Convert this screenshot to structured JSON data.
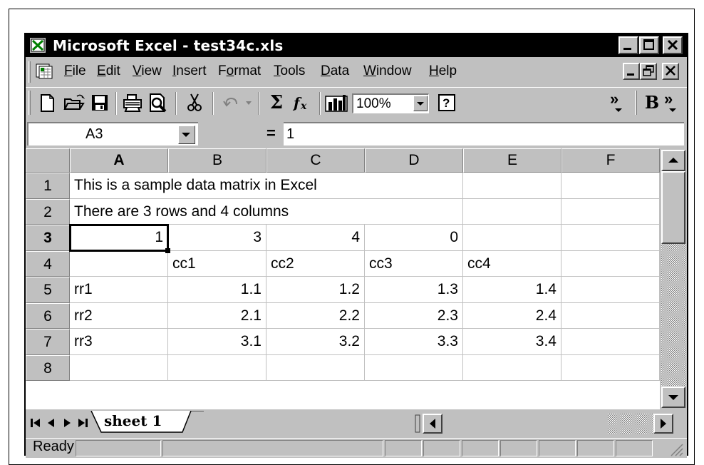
{
  "window": {
    "title": "Microsoft Excel - test34c.xls"
  },
  "menu": {
    "items": [
      "File",
      "Edit",
      "View",
      "Insert",
      "Format",
      "Tools",
      "Data",
      "Window",
      "Help"
    ],
    "mnemonics": [
      "F",
      "E",
      "V",
      "I",
      "o",
      "T",
      "D",
      "W",
      "H"
    ]
  },
  "toolbar": {
    "zoom": "100%",
    "more_glyph": "»",
    "bold_label": "B",
    "sum_glyph": "Σ",
    "fx_glyph": "fx"
  },
  "formula_bar": {
    "name_box": "A3",
    "equals": "=",
    "content": "1"
  },
  "grid": {
    "columns": [
      "A",
      "B",
      "C",
      "D",
      "E",
      "F"
    ],
    "rows": [
      "1",
      "2",
      "3",
      "4",
      "5",
      "6",
      "7",
      "8"
    ],
    "active_row": "3",
    "active_col": "A",
    "cells": {
      "r1": [
        "This is a sample data matrix in Excel",
        "",
        "",
        "",
        "",
        ""
      ],
      "r2": [
        "There are 3 rows and 4 columns",
        "",
        "",
        "",
        "",
        ""
      ],
      "r3": [
        "1",
        "3",
        "4",
        "0",
        "",
        ""
      ],
      "r4": [
        "",
        "cc1",
        "cc2",
        "cc3",
        "cc4",
        ""
      ],
      "r5": [
        "rr1",
        "1.1",
        "1.2",
        "1.3",
        "1.4",
        ""
      ],
      "r6": [
        "rr2",
        "2.1",
        "2.2",
        "2.3",
        "2.4",
        ""
      ],
      "r7": [
        "rr3",
        "3.1",
        "3.2",
        "3.3",
        "3.4",
        ""
      ],
      "r8": [
        "",
        "",
        "",
        "",
        "",
        ""
      ]
    }
  },
  "sheets": {
    "tabs": [
      "sheet 1"
    ],
    "active": "sheet 1"
  },
  "status": {
    "text": "Ready"
  }
}
